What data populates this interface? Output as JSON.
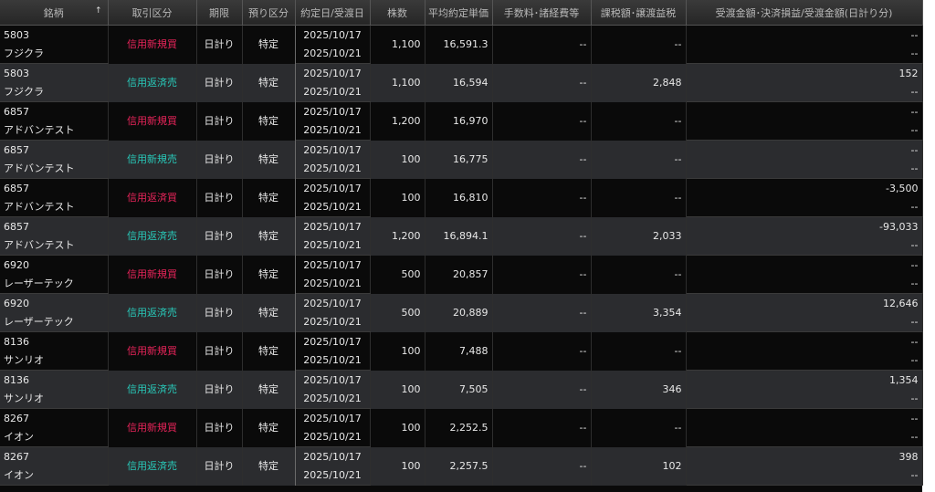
{
  "headers": {
    "symbol": "銘柄",
    "sort_arrow": "↑",
    "trade_type": "取引区分",
    "term": "期限",
    "account": "預り区分",
    "date": "約定日/受渡日",
    "shares": "株数",
    "avg_price": "平均約定単価",
    "fee": "手数料･諸経費等",
    "tax": "課税額･譲渡益税",
    "amount": "受渡金額･決済損益/受渡金額(日計り分)"
  },
  "colors": {
    "buy": "#e8245a",
    "sell": "#28c8b8"
  },
  "rows": [
    {
      "code": "5803",
      "name": "フジクラ",
      "type": "信用新規買",
      "kind": "buy",
      "term": "日計り",
      "account": "特定",
      "trade_date": "2025/10/17",
      "settle_date": "2025/10/21",
      "shares": "1,100",
      "price": "16,591.3",
      "fee": "--",
      "tax": "--",
      "amount1": "--",
      "amount2": "--"
    },
    {
      "code": "5803",
      "name": "フジクラ",
      "type": "信用返済売",
      "kind": "sell",
      "term": "日計り",
      "account": "特定",
      "trade_date": "2025/10/17",
      "settle_date": "2025/10/21",
      "shares": "1,100",
      "price": "16,594",
      "fee": "--",
      "tax": "2,848",
      "amount1": "152",
      "amount2": "--"
    },
    {
      "code": "6857",
      "name": "アドバンテスト",
      "type": "信用新規買",
      "kind": "buy",
      "term": "日計り",
      "account": "特定",
      "trade_date": "2025/10/17",
      "settle_date": "2025/10/21",
      "shares": "1,200",
      "price": "16,970",
      "fee": "--",
      "tax": "--",
      "amount1": "--",
      "amount2": "--"
    },
    {
      "code": "6857",
      "name": "アドバンテスト",
      "type": "信用新規売",
      "kind": "sell",
      "term": "日計り",
      "account": "特定",
      "trade_date": "2025/10/17",
      "settle_date": "2025/10/21",
      "shares": "100",
      "price": "16,775",
      "fee": "--",
      "tax": "--",
      "amount1": "--",
      "amount2": "--"
    },
    {
      "code": "6857",
      "name": "アドバンテスト",
      "type": "信用返済買",
      "kind": "buy",
      "term": "日計り",
      "account": "特定",
      "trade_date": "2025/10/17",
      "settle_date": "2025/10/21",
      "shares": "100",
      "price": "16,810",
      "fee": "--",
      "tax": "--",
      "amount1": "-3,500",
      "amount2": "--"
    },
    {
      "code": "6857",
      "name": "アドバンテスト",
      "type": "信用返済売",
      "kind": "sell",
      "term": "日計り",
      "account": "特定",
      "trade_date": "2025/10/17",
      "settle_date": "2025/10/21",
      "shares": "1,200",
      "price": "16,894.1",
      "fee": "--",
      "tax": "2,033",
      "amount1": "-93,033",
      "amount2": "--"
    },
    {
      "code": "6920",
      "name": "レーザーテック",
      "type": "信用新規買",
      "kind": "buy",
      "term": "日計り",
      "account": "特定",
      "trade_date": "2025/10/17",
      "settle_date": "2025/10/21",
      "shares": "500",
      "price": "20,857",
      "fee": "--",
      "tax": "--",
      "amount1": "--",
      "amount2": "--"
    },
    {
      "code": "6920",
      "name": "レーザーテック",
      "type": "信用返済売",
      "kind": "sell",
      "term": "日計り",
      "account": "特定",
      "trade_date": "2025/10/17",
      "settle_date": "2025/10/21",
      "shares": "500",
      "price": "20,889",
      "fee": "--",
      "tax": "3,354",
      "amount1": "12,646",
      "amount2": "--"
    },
    {
      "code": "8136",
      "name": "サンリオ",
      "type": "信用新規買",
      "kind": "buy",
      "term": "日計り",
      "account": "特定",
      "trade_date": "2025/10/17",
      "settle_date": "2025/10/21",
      "shares": "100",
      "price": "7,488",
      "fee": "--",
      "tax": "--",
      "amount1": "--",
      "amount2": "--"
    },
    {
      "code": "8136",
      "name": "サンリオ",
      "type": "信用返済売",
      "kind": "sell",
      "term": "日計り",
      "account": "特定",
      "trade_date": "2025/10/17",
      "settle_date": "2025/10/21",
      "shares": "100",
      "price": "7,505",
      "fee": "--",
      "tax": "346",
      "amount1": "1,354",
      "amount2": "--"
    },
    {
      "code": "8267",
      "name": "イオン",
      "type": "信用新規買",
      "kind": "buy",
      "term": "日計り",
      "account": "特定",
      "trade_date": "2025/10/17",
      "settle_date": "2025/10/21",
      "shares": "100",
      "price": "2,252.5",
      "fee": "--",
      "tax": "--",
      "amount1": "--",
      "amount2": "--"
    },
    {
      "code": "8267",
      "name": "イオン",
      "type": "信用返済売",
      "kind": "sell",
      "term": "日計り",
      "account": "特定",
      "trade_date": "2025/10/17",
      "settle_date": "2025/10/21",
      "shares": "100",
      "price": "2,257.5",
      "fee": "--",
      "tax": "102",
      "amount1": "398",
      "amount2": "--"
    }
  ]
}
